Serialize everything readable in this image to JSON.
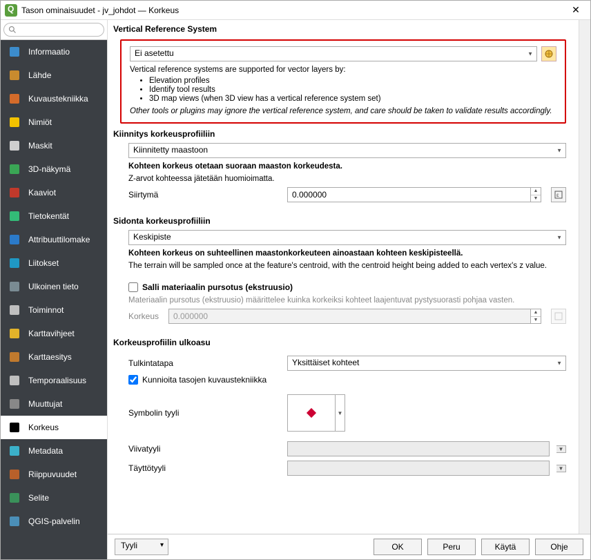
{
  "window": {
    "title": "Tason ominaisuudet - jv_johdot — Korkeus"
  },
  "search": {
    "placeholder": ""
  },
  "sidebar": {
    "items": [
      {
        "label": "Informaatio",
        "icon": "#3c8ccc"
      },
      {
        "label": "Lähde",
        "icon": "#c98b2e"
      },
      {
        "label": "Kuvaustekniikka",
        "icon": "#d46b2a"
      },
      {
        "label": "Nimiöt",
        "icon": "#f2c200"
      },
      {
        "label": "Maskit",
        "icon": "#cfcfcf"
      },
      {
        "label": "3D-näkymä",
        "icon": "#3aa655"
      },
      {
        "label": "Kaaviot",
        "icon": "#c0392b"
      },
      {
        "label": "Tietokentät",
        "icon": "#3b7"
      },
      {
        "label": "Attribuuttilomake",
        "icon": "#2b7ac9"
      },
      {
        "label": "Liitokset",
        "icon": "#1f98c4"
      },
      {
        "label": "Ulkoinen tieto",
        "icon": "#7a8b93"
      },
      {
        "label": "Toiminnot",
        "icon": "#bfbfbf"
      },
      {
        "label": "Karttavihjeet",
        "icon": "#e2b32a"
      },
      {
        "label": "Karttaesitys",
        "icon": "#c07a2e"
      },
      {
        "label": "Temporaalisuus",
        "icon": "#bfbfbf"
      },
      {
        "label": "Muuttujat",
        "icon": "#888"
      },
      {
        "label": "Korkeus",
        "icon": "#4c94b",
        "active": true
      },
      {
        "label": "Metadata",
        "icon": "#3bb0c9"
      },
      {
        "label": "Riippuvuudet",
        "icon": "#b8602a"
      },
      {
        "label": "Selite",
        "icon": "#3a915a"
      },
      {
        "label": "QGIS-palvelin",
        "icon": "#4b8fb8"
      }
    ]
  },
  "vrs": {
    "header": "Vertical Reference System",
    "value": "Ei asetettu",
    "help_intro": "Vertical reference systems are supported for vector layers by:",
    "bullets": [
      "Elevation profiles",
      "Identify tool results",
      "3D map views (when 3D view has a vertical reference system set)"
    ],
    "note": "Other tools or plugins may ignore the vertical reference system, and care should be taken to validate results accordingly."
  },
  "clamp": {
    "header": "Kiinnitys korkeusprofiiliin",
    "value": "Kiinnitetty maastoon",
    "bold": "Kohteen korkeus otetaan suoraan maaston korkeudesta.",
    "desc": "Z-arvot kohteessa jätetään huomioimatta.",
    "offset_label": "Siirtymä",
    "offset_value": "0.000000"
  },
  "binding": {
    "header": "Sidonta korkeusprofiiliin",
    "value": "Keskipiste",
    "bold": "Kohteen korkeus on suhteellinen maastonkorkeuteen ainoastaan kohteen keskipisteellä.",
    "desc": "The terrain will be sampled once at the feature's centroid, with the centroid height being added to each vertex's z value."
  },
  "extrusion": {
    "checkbox_label": "Salli materiaalin pursotus (ekstruusio)",
    "checked": false,
    "desc": "Materiaalin pursotus (ekstruusio) määrittelee kuinka korkeiksi kohteet laajentuvat pystysuorasti pohjaa vasten.",
    "height_label": "Korkeus",
    "height_value": "0.000000"
  },
  "appearance": {
    "header": "Korkeusprofiilin ulkoasu",
    "interpretation_label": "Tulkintatapa",
    "interpretation_value": "Yksittäiset kohteet",
    "respect_label": "Kunnioita tasojen kuvaustekniikka",
    "respect_checked": true,
    "symbol_label": "Symbolin tyyli",
    "line_label": "Viivatyyli",
    "fill_label": "Täyttötyyli"
  },
  "footer": {
    "style": "Tyyli",
    "ok": "OK",
    "cancel": "Peru",
    "apply": "Käytä",
    "help": "Ohje"
  }
}
